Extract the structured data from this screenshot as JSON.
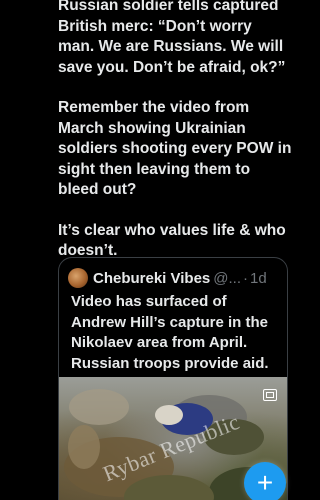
{
  "tweet": {
    "lines_para1": [
      "Russian soldier tells captured",
      "British merc: “Don’t worry",
      "man. We are Russians. We will",
      "save you. Don’t be afraid, ok?”"
    ],
    "lines_para2": [
      "Remember the video from",
      "March showing Ukrainian",
      "soldiers shooting every POW in",
      "sight then leaving them to",
      "bleed out?"
    ],
    "lines_para3": [
      "It’s clear who values life & who",
      "doesn’t."
    ]
  },
  "quote": {
    "author_name": "Chebureki Vibes",
    "handle": "@...",
    "separator": "·",
    "time": "1d",
    "lines": [
      "Video has surfaced of",
      "Andrew Hill’s capture in the",
      "Nikolaev area from April.",
      "Russian troops provide aid."
    ],
    "media": {
      "watermark": "Rybar Republic",
      "icon": "gallery-icon"
    }
  },
  "fab": {
    "label": "+",
    "icon": "compose-plus-icon",
    "color": "#1d9bf0"
  }
}
